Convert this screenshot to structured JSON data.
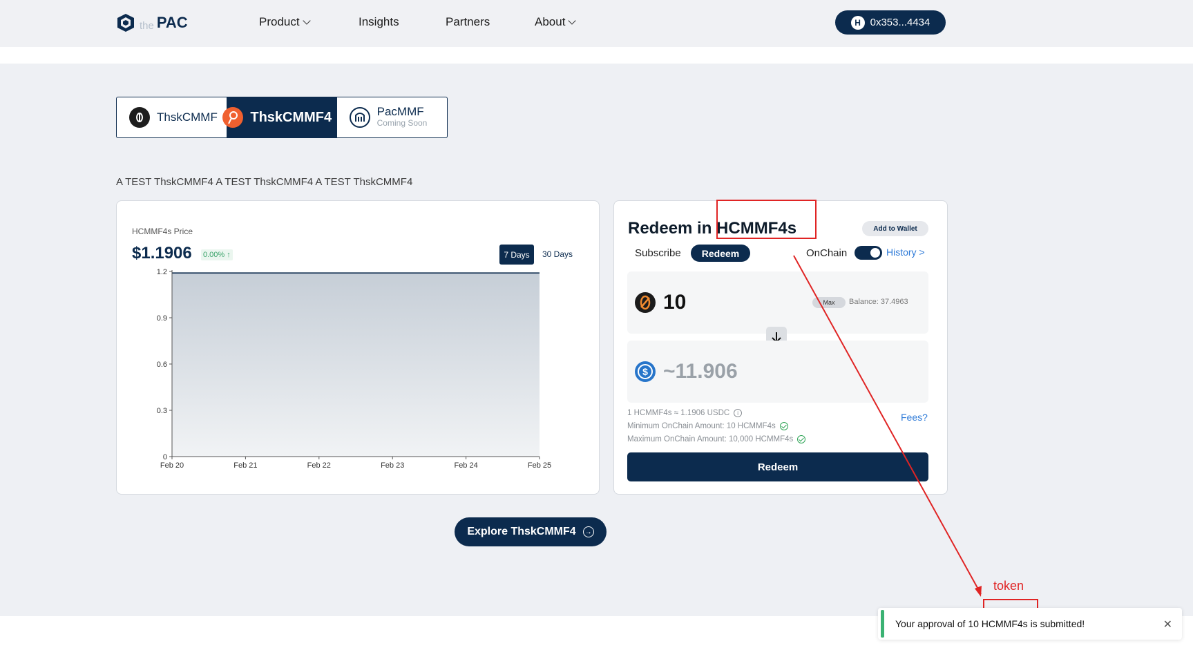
{
  "nav": {
    "logo_the": "the",
    "logo_pac": "PAC",
    "items": [
      {
        "label": "Product",
        "has_dropdown": true
      },
      {
        "label": "Insights",
        "has_dropdown": false
      },
      {
        "label": "Partners",
        "has_dropdown": false
      },
      {
        "label": "About",
        "has_dropdown": true
      }
    ],
    "wallet_address": "0x353...4434",
    "wallet_icon": "H"
  },
  "fund_tabs": [
    {
      "label": "ThskCMMF",
      "sub": "",
      "icon": "coin-icon",
      "active": false
    },
    {
      "label": "ThskCMMF4",
      "sub": "",
      "icon": "pin-icon",
      "active": true
    },
    {
      "label": "PacMMF",
      "sub": "Coming Soon",
      "icon": "pac-icon",
      "active": false
    }
  ],
  "description": "A TEST ThskCMMF4 A TEST ThskCMMF4 A TEST ThskCMMF4",
  "chart_card": {
    "price_label": "HCMMF4s Price",
    "price_value": "$1.1906",
    "price_change": "0.00% ↑",
    "range_7": "7 Days",
    "range_30": "30 Days"
  },
  "chart_data": {
    "type": "area",
    "x": [
      "Feb 20",
      "Feb 21",
      "Feb 22",
      "Feb 23",
      "Feb 24",
      "Feb 25"
    ],
    "values": [
      1.19,
      1.19,
      1.19,
      1.19,
      1.19,
      1.19
    ],
    "ylim": [
      0,
      1.2
    ],
    "yticks": [
      "0",
      "0.3",
      "0.6",
      "0.9",
      "1.2"
    ],
    "title": "",
    "xlabel": "",
    "ylabel": "",
    "grid": false,
    "colors": {
      "line": "#0c2b4e",
      "fill": "#c9d0d8"
    }
  },
  "redeem": {
    "title_prefix": "Redeem in",
    "title_token": "HCMMF4s",
    "add_wallet": "Add to Wallet",
    "tab_subscribe": "Subscribe",
    "tab_redeem": "Redeem",
    "onchain_label": "OnChain",
    "history": "History >",
    "input_amount": "10",
    "max_label": "Max",
    "balance": "Balance: 37.4963",
    "output_amount": "~11.906",
    "rate": "1 HCMMF4s ≈ 1.1906 USDC",
    "min_amount": "Minimum OnChain Amount: 10 HCMMF4s",
    "max_amount": "Maximum OnChain Amount: 10,000 HCMMF4s",
    "fees": "Fees?",
    "button": "Redeem"
  },
  "explore_button": "Explore ThskCMMF4",
  "annotation": {
    "label": "token",
    "color": "#e02424"
  },
  "toast": {
    "message": "Your approval of 10 HCMMF4s is submitted!",
    "close": "✕"
  },
  "colors": {
    "primary": "#0c2b4e",
    "accent": "#2f7bd8",
    "success": "#3bb273"
  }
}
